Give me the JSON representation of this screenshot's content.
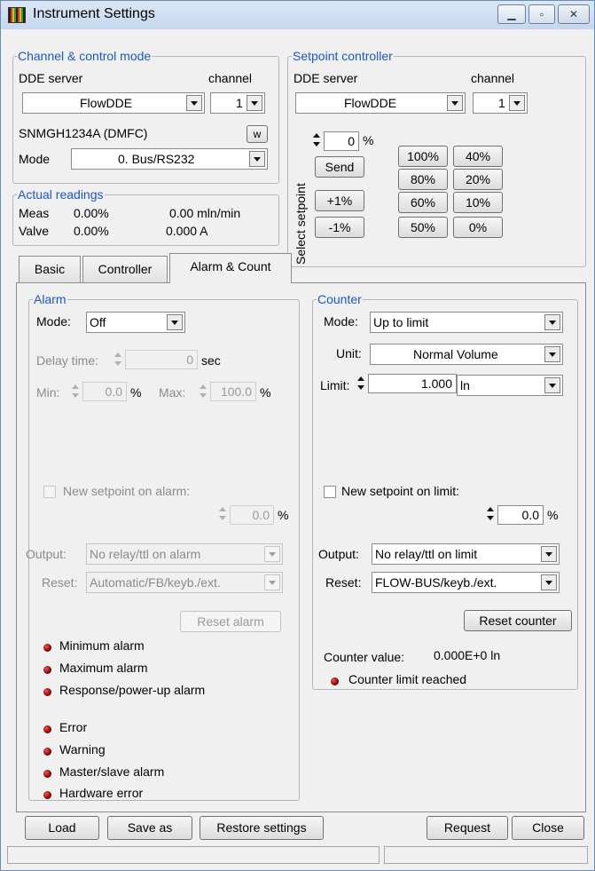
{
  "window": {
    "title": "Instrument Settings",
    "icon": "instrument-app-icon"
  },
  "channel_control": {
    "legend": "Channel & control mode",
    "dde_label": "DDE server",
    "channel_label": "channel",
    "dde_value": "FlowDDE",
    "channel_value": "1",
    "device": "SNMGH1234A (DMFC)",
    "w_button": "w",
    "mode_label": "Mode",
    "mode_value": "0. Bus/RS232"
  },
  "actual_readings": {
    "legend": "Actual readings",
    "meas_label": "Meas",
    "meas_pct": "0.00%",
    "meas_flow": "0.00 mln/min",
    "valve_label": "Valve",
    "valve_pct": "0.00%",
    "valve_current": "0.000 A"
  },
  "setpoint_controller": {
    "legend": "Setpoint controller",
    "dde_label": "DDE server",
    "channel_label": "channel",
    "dde_value": "FlowDDE",
    "channel_value": "1",
    "select_label": "Select setpoint",
    "setpoint_value": "0",
    "setpoint_unit": "%",
    "send": "Send",
    "plus1": "+1%",
    "minus1": "-1%",
    "presets": [
      "100%",
      "40%",
      "80%",
      "20%",
      "60%",
      "10%",
      "50%",
      "0%"
    ]
  },
  "tabs": [
    "Basic",
    "Controller",
    "Alarm & Count"
  ],
  "alarm": {
    "legend": "Alarm",
    "mode_label": "Mode:",
    "mode_value": "Off",
    "delay_label": "Delay time:",
    "delay_value": "0",
    "delay_unit": "sec",
    "min_label": "Min:",
    "min_value": "0.0",
    "min_unit": "%",
    "max_label": "Max:",
    "max_value": "100.0",
    "max_unit": "%",
    "new_setpoint_label": "New setpoint on alarm:",
    "new_setpoint_value": "0.0",
    "new_setpoint_unit": "%",
    "output_label": "Output:",
    "output_value": "No relay/ttl on alarm",
    "reset_label": "Reset:",
    "reset_value": "Automatic/FB/keyb./ext.",
    "reset_button": "Reset alarm",
    "indicators": [
      "Minimum alarm",
      "Maximum alarm",
      "Response/power-up alarm"
    ],
    "status_indicators": [
      "Error",
      "Warning",
      "Master/slave alarm",
      "Hardware error"
    ]
  },
  "counter": {
    "legend": "Counter",
    "mode_label": "Mode:",
    "mode_value": "Up to limit",
    "unit_label": "Unit:",
    "unit_value": "Normal Volume",
    "limit_label": "Limit:",
    "limit_value": "1.000",
    "limit_unit": "ln",
    "new_setpoint_label": "New setpoint on limit:",
    "new_setpoint_value": "0.0",
    "new_setpoint_unit": "%",
    "output_label": "Output:",
    "output_value": "No relay/ttl on limit",
    "reset_label": "Reset:",
    "reset_value": "FLOW-BUS/keyb./ext.",
    "reset_button": "Reset counter",
    "value_label": "Counter value:",
    "value": "0.000E+0 ln",
    "limit_reached": "Counter limit reached"
  },
  "footer": {
    "load": "Load",
    "save_as": "Save as",
    "restore": "Restore settings",
    "request": "Request",
    "close": "Close"
  },
  "colors": {
    "legend": "#1f57c2",
    "led": "#8b0000",
    "window_bg": "#f0f0f0"
  }
}
